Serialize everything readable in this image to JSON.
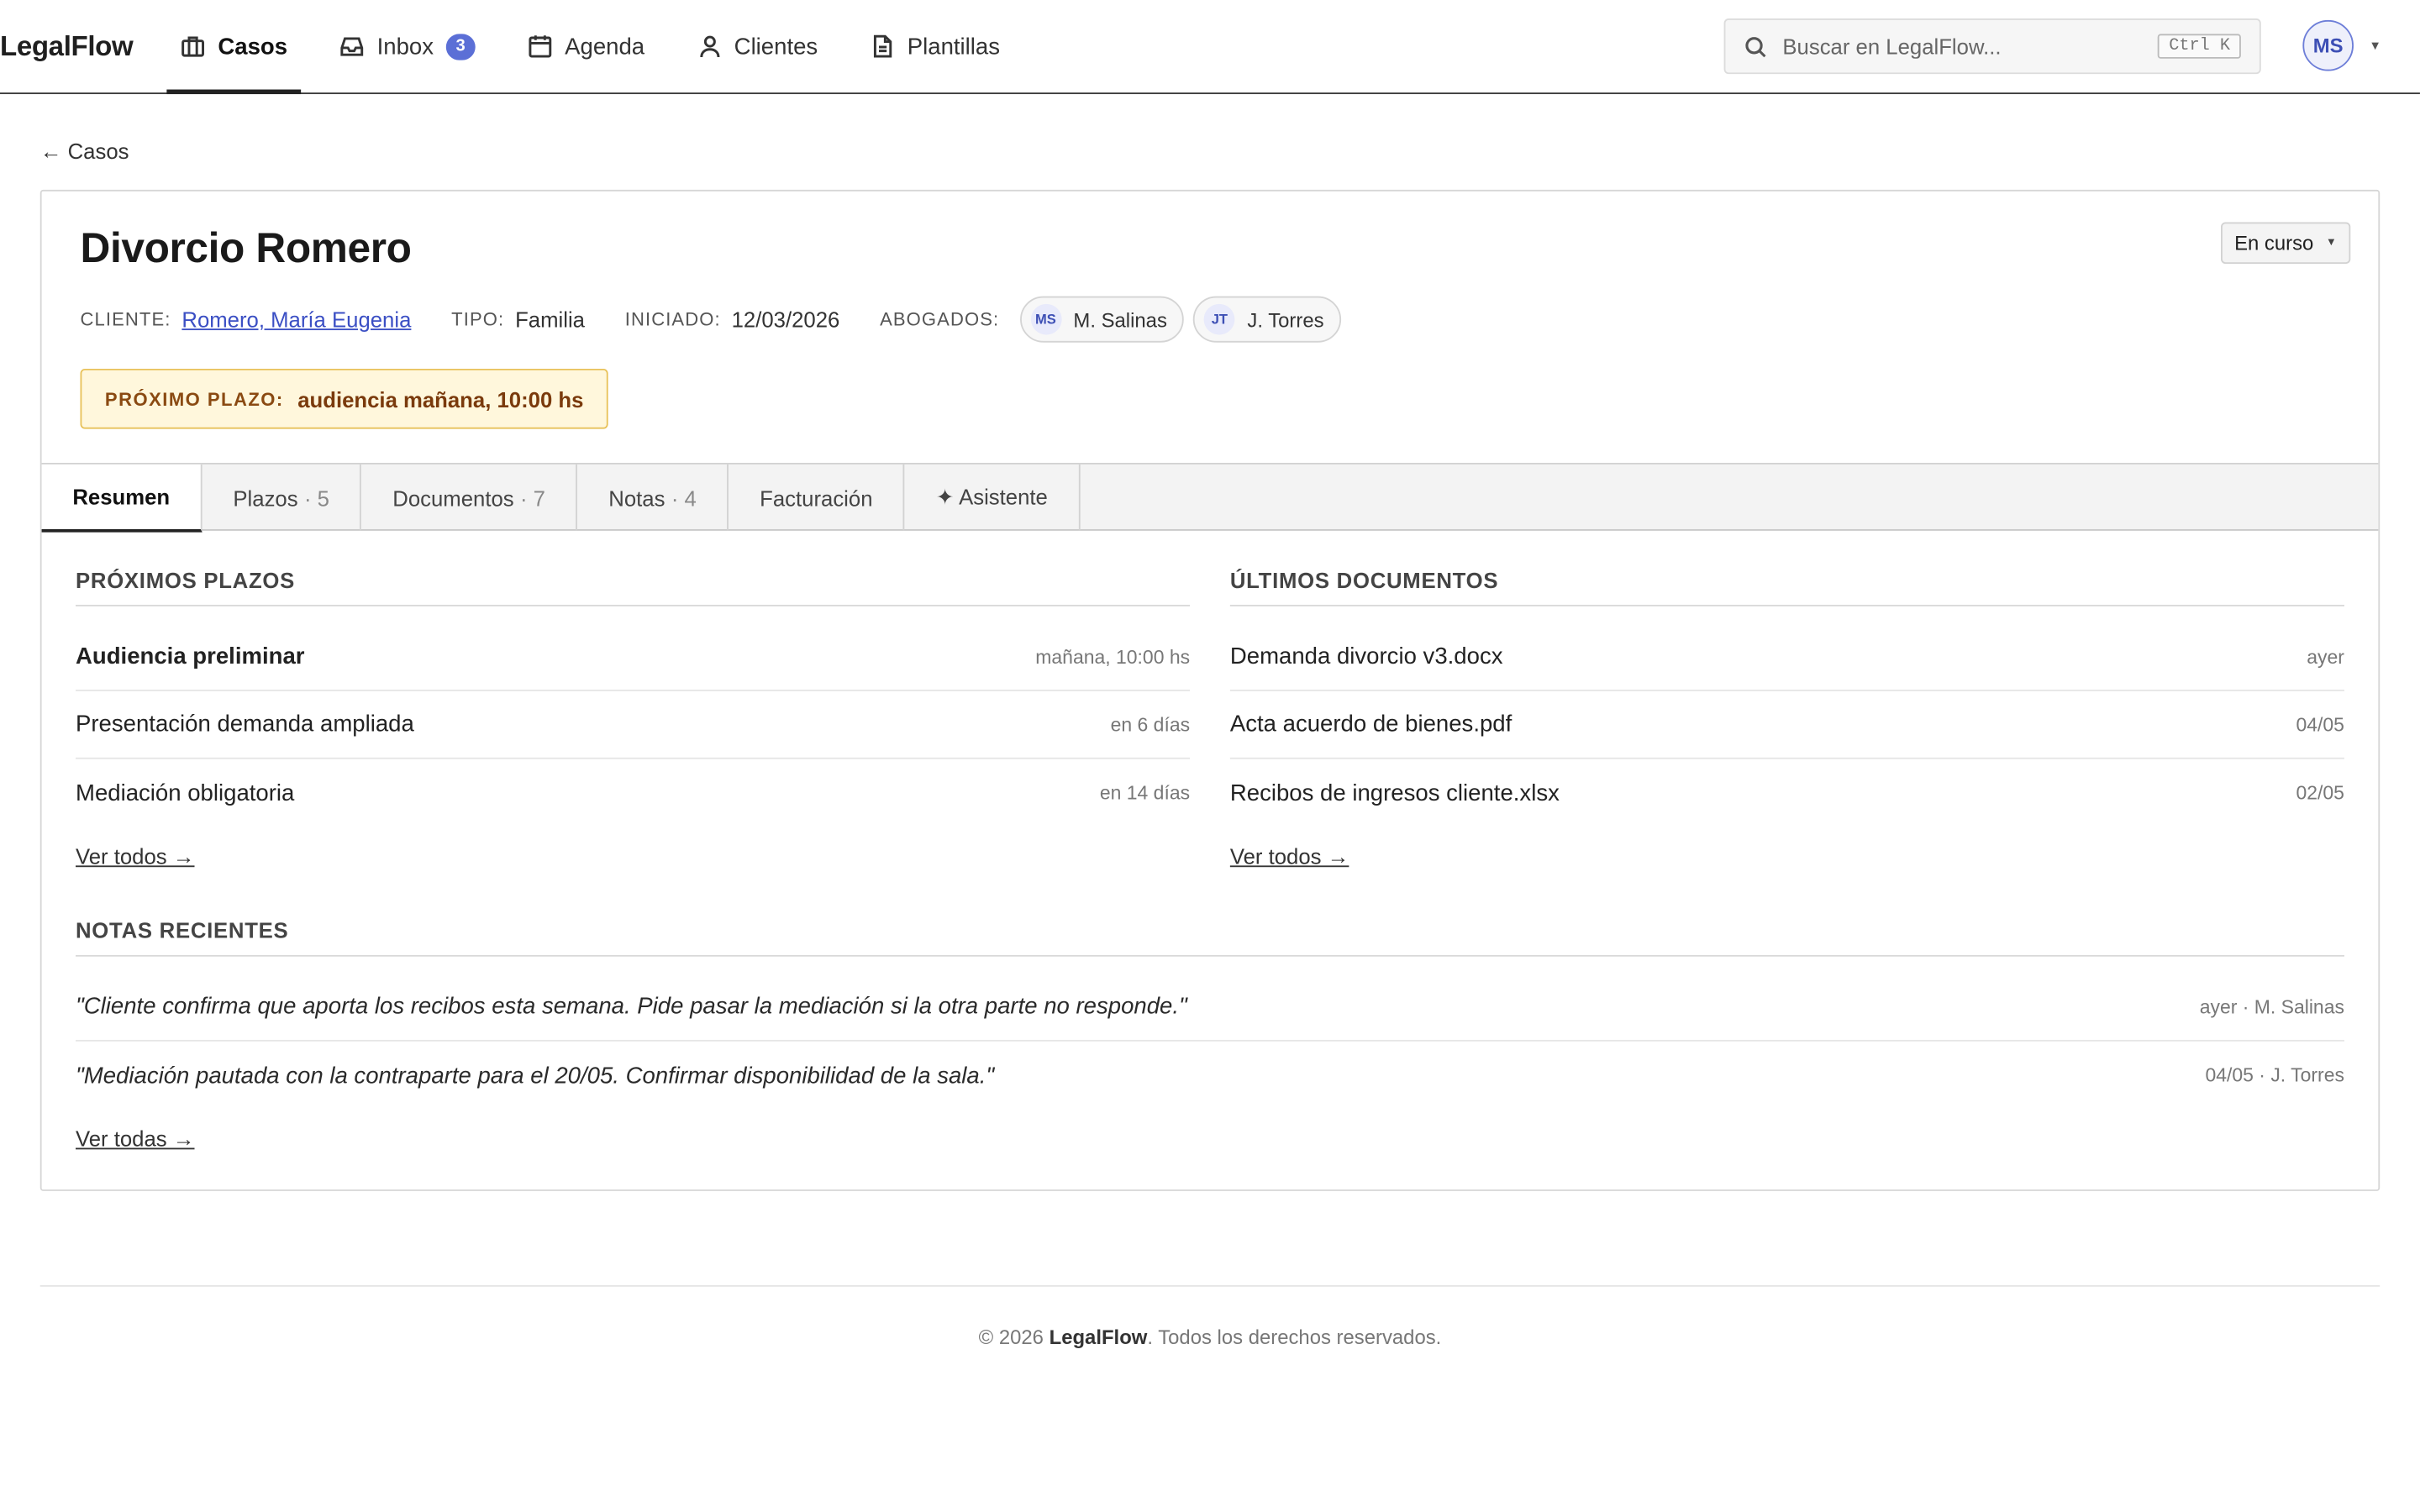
{
  "app": {
    "brand": "LegalFlow"
  },
  "nav": {
    "items": [
      {
        "label": "Casos",
        "icon": "briefcase-icon",
        "active": true
      },
      {
        "label": "Inbox",
        "icon": "inbox-icon",
        "badge": "3"
      },
      {
        "label": "Agenda",
        "icon": "calendar-icon"
      },
      {
        "label": "Clientes",
        "icon": "user-icon"
      },
      {
        "label": "Plantillas",
        "icon": "document-icon"
      }
    ]
  },
  "search": {
    "placeholder": "Buscar en LegalFlow...",
    "shortcut": "Ctrl K"
  },
  "user": {
    "initials": "MS"
  },
  "breadcrumb": {
    "back_label": "← Casos"
  },
  "case": {
    "title": "Divorcio Romero",
    "status": "En curso",
    "client_label": "CLIENTE:",
    "client": "Romero, María Eugenia",
    "type_label": "TIPO:",
    "type": "Familia",
    "started_label": "INICIADO:",
    "started": "12/03/2026",
    "lawyers_label": "ABOGADOS:",
    "lawyers": [
      {
        "initials": "MS",
        "name": "M. Salinas"
      },
      {
        "initials": "JT",
        "name": "J. Torres"
      }
    ],
    "next_deadline_label": "PRÓXIMO PLAZO:",
    "next_deadline": "audiencia mañana, 10:00 hs"
  },
  "tabs": [
    {
      "label": "Resumen",
      "count": "",
      "active": true
    },
    {
      "label": "Plazos",
      "count": "· 5"
    },
    {
      "label": "Documentos",
      "count": "· 7"
    },
    {
      "label": "Notas",
      "count": "· 4"
    },
    {
      "label": "Facturación",
      "count": ""
    },
    {
      "label": "✦ Asistente",
      "count": ""
    }
  ],
  "deadlines": {
    "heading": "PRÓXIMOS PLAZOS",
    "items": [
      {
        "title": "Audiencia preliminar",
        "when": "mañana, 10:00 hs"
      },
      {
        "title": "Presentación demanda ampliada",
        "when": "en 6 días"
      },
      {
        "title": "Mediación obligatoria",
        "when": "en 14 días"
      }
    ],
    "more": "Ver todos →"
  },
  "documents": {
    "heading": "ÚLTIMOS DOCUMENTOS",
    "items": [
      {
        "title": "Demanda divorcio v3.docx",
        "when": "ayer"
      },
      {
        "title": "Acta acuerdo de bienes.pdf",
        "when": "04/05"
      },
      {
        "title": "Recibos de ingresos cliente.xlsx",
        "when": "02/05"
      }
    ],
    "more": "Ver todos →"
  },
  "notes": {
    "heading": "NOTAS RECIENTES",
    "items": [
      {
        "text": "\"Cliente confirma que aporta los recibos esta semana. Pide pasar la mediación si la otra parte no responde.\"",
        "meta": "ayer · M. Salinas"
      },
      {
        "text": "\"Mediación pautada con la contraparte para el 20/05. Confirmar disponibilidad de la sala.\"",
        "meta": "04/05 · J. Torres"
      }
    ],
    "more": "Ver todas →"
  },
  "footer": {
    "prefix": "© 2026 ",
    "brand": "LegalFlow",
    "suffix": ". Todos los derechos reservados."
  },
  "colors": {
    "accent": "#5b6fd6",
    "deadline_bg": "#fff7dc",
    "deadline_border": "#e8c25a"
  }
}
